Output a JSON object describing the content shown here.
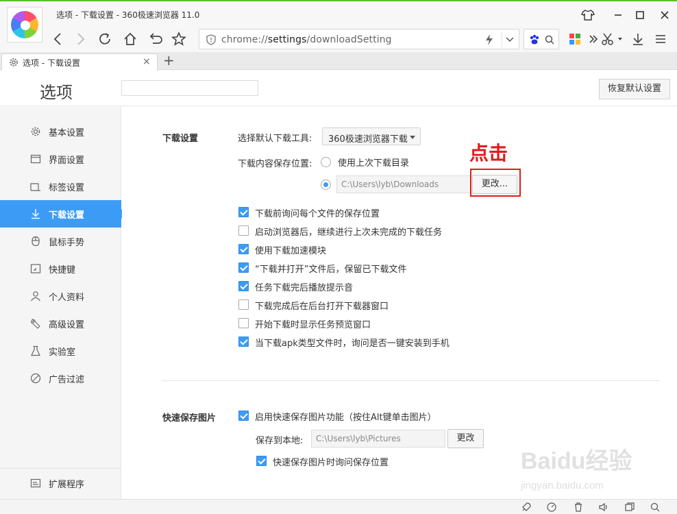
{
  "window": {
    "title": "选项 - 下载设置 - 360极速浏览器 11.0"
  },
  "address_bar": {
    "prefix": "chrome://",
    "bold": "settings",
    "suffix": "/downloadSetting"
  },
  "tab": {
    "label": "选项 - 下载设置",
    "close": "×",
    "new_tab": "+"
  },
  "header": {
    "title": "选项",
    "search_placeholder": "",
    "restore_button": "恢复默认设置"
  },
  "sidebar": {
    "items": [
      {
        "label": "基本设置",
        "icon": "gear-icon"
      },
      {
        "label": "界面设置",
        "icon": "window-icon"
      },
      {
        "label": "标签设置",
        "icon": "tab-icon"
      },
      {
        "label": "下载设置",
        "icon": "download-icon",
        "active": true
      },
      {
        "label": "鼠标手势",
        "icon": "mouse-icon"
      },
      {
        "label": "快捷键",
        "icon": "keyboard-icon"
      },
      {
        "label": "个人资料",
        "icon": "user-icon"
      },
      {
        "label": "高级设置",
        "icon": "wrench-icon"
      },
      {
        "label": "实验室",
        "icon": "flask-icon"
      },
      {
        "label": "广告过滤",
        "icon": "block-icon"
      }
    ],
    "bottom": {
      "label": "扩展程序",
      "icon": "extension-icon"
    }
  },
  "download": {
    "section_title": "下载设置",
    "tool_label": "选择默认下载工具:",
    "tool_value": "360极速浏览器下载",
    "location_label": "下载内容保存位置:",
    "radio_last": "使用上次下载目录",
    "path": "C:\\Users\\lyb\\Downloads",
    "change_button": "更改...",
    "options": [
      {
        "label": "下载前询问每个文件的保存位置",
        "checked": true
      },
      {
        "label": "启动浏览器后，继续进行上次未完成的下载任务",
        "checked": false
      },
      {
        "label": "使用下载加速模块",
        "checked": true
      },
      {
        "label": "“下载并打开”文件后，保留已下载文件",
        "checked": true
      },
      {
        "label": "任务下载完后播放提示音",
        "checked": true
      },
      {
        "label": "下载完成后在后台打开下载器窗口",
        "checked": false
      },
      {
        "label": "开始下载时显示任务预览窗口",
        "checked": false
      },
      {
        "label": "当下载apk类型文件时，询问是否一键安装到手机",
        "checked": true
      }
    ]
  },
  "quick_save": {
    "section_title": "快速保存图片",
    "enable_label": "启用快速保存图片功能（按住Alt键单击图片）",
    "save_to_label": "保存到本地:",
    "path": "C:\\Users\\lyb\\Pictures",
    "change_button": "更改",
    "ask_label": "快速保存图片时询问保存位置"
  },
  "annotation": {
    "text": "点击",
    "color": "#e21a1a"
  },
  "watermark": {
    "text": "Baidu经验",
    "sub": "jingyan.baidu.com"
  },
  "colors": {
    "accent": "#3c9cf5",
    "chrome_top": "#5cbf2a"
  }
}
